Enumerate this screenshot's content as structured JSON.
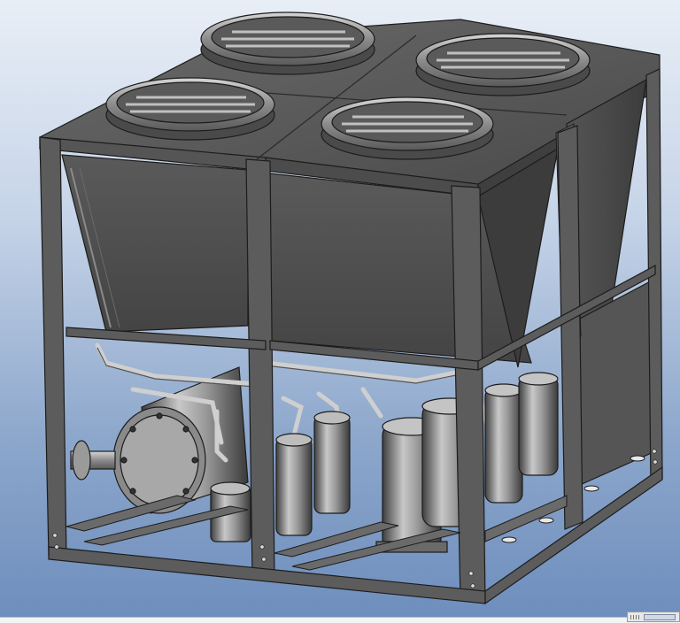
{
  "viewport": {
    "background_top": "#e8eef6",
    "background_bottom": "#6e8ebd"
  },
  "model": {
    "frame_color": "#5c5c5c",
    "frame_edge": "#1e1e1e",
    "panel_color": "#505050",
    "metal_light": "#b4b4b4",
    "metal_dark": "#3a3a3a"
  },
  "icons": {
    "corner_widget": "resize-grip-icon"
  }
}
